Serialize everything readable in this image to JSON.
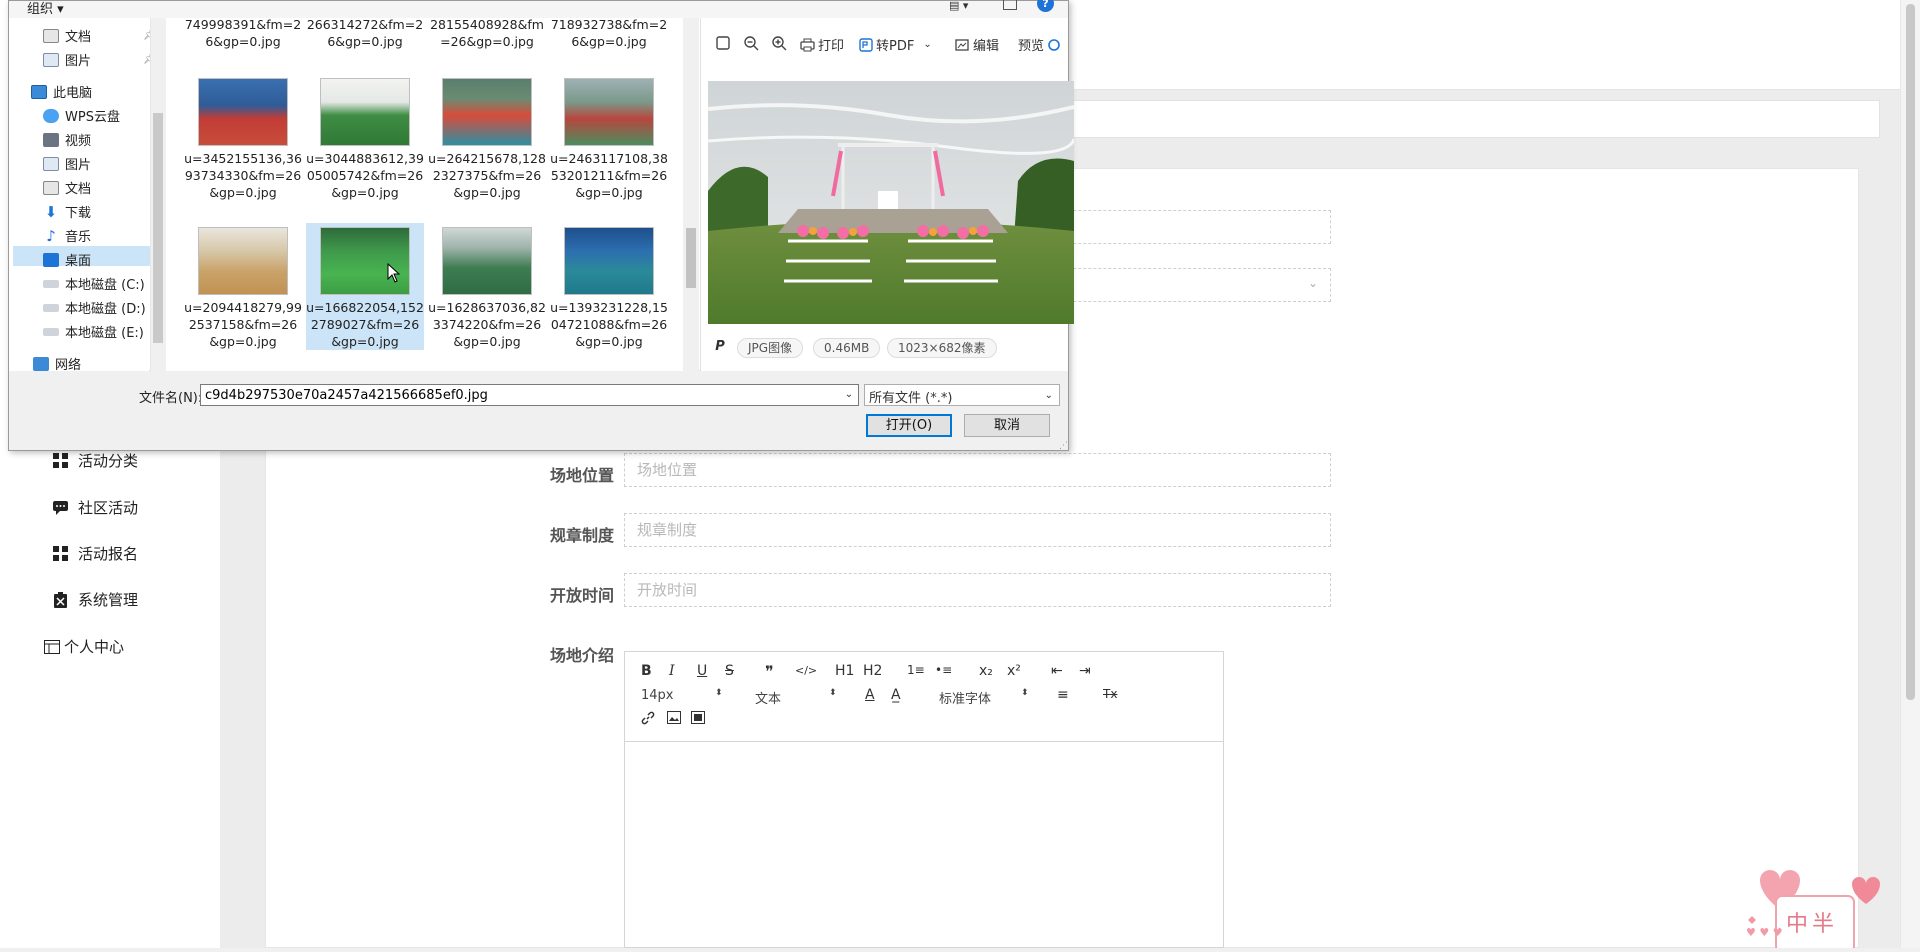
{
  "app": {
    "sidebar_items": [
      {
        "label": "活动分类",
        "icon": "grid-icon"
      },
      {
        "label": "社区活动",
        "icon": "chat-icon"
      },
      {
        "label": "活动报名",
        "icon": "grid-icon"
      },
      {
        "label": "系统管理",
        "icon": "clipboard-icon"
      },
      {
        "label": "个人中心",
        "icon": "window-icon"
      }
    ],
    "form": {
      "location_label": "场地位置",
      "location_placeholder": "场地位置",
      "rules_label": "规章制度",
      "rules_placeholder": "规章制度",
      "hours_label": "开放时间",
      "hours_placeholder": "开放时间",
      "intro_label": "场地介绍"
    },
    "editor": {
      "font_size": "14px",
      "text_style": "文本",
      "font_family": "标准字体",
      "buttons": [
        "B",
        "I",
        "U",
        "S",
        "❞",
        "</>",
        "H1",
        "H2",
        "1≡",
        "•≡",
        "x₂",
        "x²",
        "⇤",
        "⇥",
        "A",
        "A̲",
        "≡",
        "Tx"
      ]
    },
    "sticker_text": "中半",
    "sticker_hearts": "♥ ♥ ♥"
  },
  "dialog": {
    "organize_label": "组织 ▾",
    "tree_items": [
      {
        "label": "文档",
        "pinned": true
      },
      {
        "label": "图片",
        "pinned": true
      },
      {
        "label": "此电脑"
      },
      {
        "label": "WPS云盘"
      },
      {
        "label": "视频"
      },
      {
        "label": "图片"
      },
      {
        "label": "文档"
      },
      {
        "label": "下载"
      },
      {
        "label": "音乐"
      },
      {
        "label": "桌面",
        "selected": true
      },
      {
        "label": "本地磁盘 (C:)"
      },
      {
        "label": "本地磁盘 (D:)"
      },
      {
        "label": "本地磁盘 (E:)"
      },
      {
        "label": "网络"
      }
    ],
    "top_row_files": [
      "749998391&fm=26&gp=0.jpg",
      "266314272&fm=26&gp=0.jpg",
      "28155408928&fm=26&gp=0.jpg",
      "718932738&fm=26&gp=0.jpg"
    ],
    "files_row1": [
      {
        "name": "u=3452155136,3693734330&fm=26&gp=0.jpg",
        "thumb": "pingpong"
      },
      {
        "name": "u=3044883612,3905005742&fm=26&gp=0.jpg",
        "thumb": "soccer-white"
      },
      {
        "name": "u=264215678,1282327375&fm=26&gp=0.jpg",
        "thumb": "court-red"
      },
      {
        "name": "u=2463117108,3853201211&fm=26&gp=0.jpg",
        "thumb": "court-red-green"
      }
    ],
    "files_row2": [
      {
        "name": "u=2094418279,992537158&fm=26&gp=0.jpg",
        "thumb": "basketball"
      },
      {
        "name": "u=166822054,1522789027&fm=26&gp=0.jpg",
        "thumb": "soccer-green",
        "selected": true
      },
      {
        "name": "u=1628637036,823374220&fm=26&gp=0.jpg",
        "thumb": "soccer-indoor"
      },
      {
        "name": "u=1393231228,1504721088&fm=26&gp=0.jpg",
        "thumb": "badminton"
      }
    ],
    "preview_toolbar": {
      "print": "打印",
      "to_pdf": "转PDF",
      "edit": "编辑",
      "preview": "预览"
    },
    "preview_meta": {
      "type": "JPG图像",
      "size": "0.46MB",
      "dimensions": "1023×682像素"
    },
    "filename_label": "文件名(N):",
    "filename_value": "c9d4b297530e70a2457a421566685ef0.jpg",
    "filetype_value": "所有文件 (*.*)",
    "open_button": "打开(O)",
    "cancel_button": "取消"
  }
}
